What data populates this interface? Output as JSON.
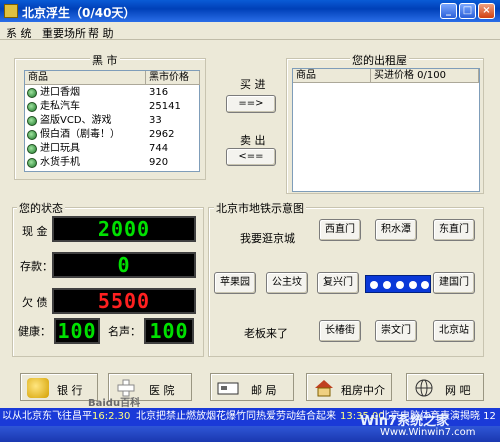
{
  "window": {
    "title": "北京浮生（0/40天）"
  },
  "menu": {
    "items": [
      "系 统",
      "重要场所",
      "帮 助"
    ]
  },
  "black_market": {
    "label": "黑 市",
    "col_item": "商品",
    "col_price": "黑市价格",
    "rows": [
      {
        "name": "进口香烟",
        "price": "316"
      },
      {
        "name": "走私汽车",
        "price": "25141"
      },
      {
        "name": "盗版VCD、游戏",
        "price": "33"
      },
      {
        "name": "假白酒（剧毒！）",
        "price": "2962"
      },
      {
        "name": "进口玩具",
        "price": "744"
      },
      {
        "name": "水货手机",
        "price": "920"
      }
    ]
  },
  "trade": {
    "buy_label": "买 进",
    "buy_button": "==>",
    "sell_label": "卖 出",
    "sell_button": "<=="
  },
  "rental": {
    "label": "您的出租屋",
    "col_item": "商品",
    "col_price": "买进价格 0/100"
  },
  "status": {
    "label": "您的状态",
    "cash_label": "现 金",
    "cash_value": "2000",
    "deposit_label": "存款：",
    "deposit_value": "0",
    "debt_label": "欠 债",
    "debt_value": "5500",
    "health_label": "健康：",
    "health_value": "100",
    "fame_label": "名声：",
    "fame_value": "100"
  },
  "subway": {
    "label": "北京市地铁示意图",
    "row1_text": "我要逛京城",
    "xizhimen": "西直门",
    "jishuitan": "积水潭",
    "dongzhimen": "东直门",
    "pingguoyuan": "苹果园",
    "gongzhufen": "公主坟",
    "fuxingmen": "复兴门",
    "jianguomen": "建国门",
    "row3_text": "老板来了",
    "changchunjie": "长椿街",
    "chongwenmen": "崇文门",
    "beijingzhan": "北京站"
  },
  "places": [
    "银 行",
    "医 院",
    "邮 局",
    "租房中介",
    "网 吧"
  ],
  "ticker": {
    "text1": "以从北京东飞往昌平",
    "time1": "16:2.30",
    "text2": "北京把禁止燃放烟花爆竹同热爱劳动结合起来",
    "time2": "13:35.00",
    "text3": "北京电脑体育表演揭晓 12"
  },
  "watermarks": {
    "baidu": "Baidu百科",
    "winwin": "Win7系统之家",
    "url": "Www.Winwin7.com"
  }
}
